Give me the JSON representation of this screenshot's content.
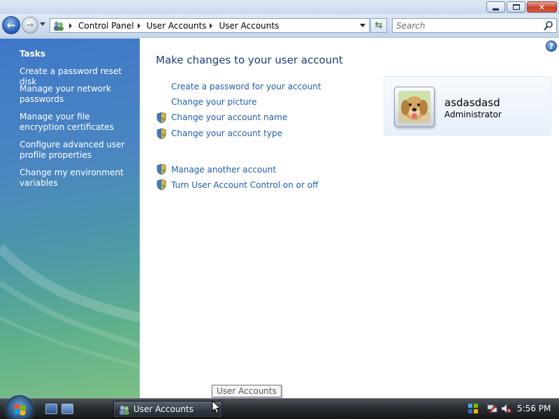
{
  "window": {
    "controls": [
      "minimize",
      "maximize",
      "close"
    ]
  },
  "navigation": {
    "breadcrumb": [
      "Control Panel",
      "User Accounts",
      "User Accounts"
    ],
    "search_placeholder": "Search"
  },
  "sidebar": {
    "title": "Tasks",
    "tasks": [
      "Create a password reset disk",
      "Manage your network passwords",
      "Manage your file encryption certificates",
      "Configure advanced user profile properties",
      "Change my environment variables"
    ]
  },
  "main": {
    "title": "Make changes to your user account",
    "actions": [
      {
        "label": "Create a password for your account",
        "shield": false
      },
      {
        "label": "Change your picture",
        "shield": false
      },
      {
        "label": "Change your account name",
        "shield": true
      },
      {
        "label": "Change your account type",
        "shield": true
      },
      {
        "label": "Manage another account",
        "shield": true
      },
      {
        "label": "Turn User Account Control on or off",
        "shield": true
      }
    ]
  },
  "user": {
    "name": "asdasdasd",
    "role": "Administrator"
  },
  "tooltip": "User Accounts",
  "taskbar": {
    "active_window": "User Accounts",
    "clock": "5:56 PM"
  },
  "colors": {
    "link": "#1c5fb0",
    "title": "#1e3c78",
    "sidebar_text": "#ffffff"
  }
}
